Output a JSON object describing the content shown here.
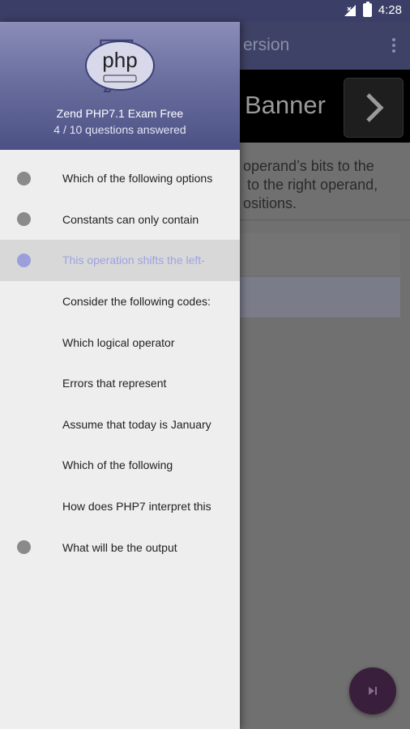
{
  "status_bar": {
    "time": "4:28"
  },
  "background": {
    "toolbar_title_fragment": "ersion",
    "banner_text": "Banner",
    "question_fragment": "operand’s bits to the\n to the right operand,\nositions."
  },
  "drawer": {
    "app_title": "Zend PHP7.1 Exam Free",
    "progress": "4 / 10 questions answered",
    "items": [
      {
        "label": "Which of the following options",
        "answered": true,
        "active": false
      },
      {
        "label": "Constants can only contain",
        "answered": true,
        "active": false
      },
      {
        "label": "This operation shifts the left-",
        "answered": true,
        "active": true
      },
      {
        "label": "Consider the following codes:",
        "answered": false,
        "active": false
      },
      {
        "label": "Which logical operator",
        "answered": false,
        "active": false
      },
      {
        "label": "Errors that represent",
        "answered": false,
        "active": false
      },
      {
        "label": "Assume that today is January",
        "answered": false,
        "active": false
      },
      {
        "label": "Which of the following",
        "answered": false,
        "active": false
      },
      {
        "label": "How does PHP7 interpret this",
        "answered": false,
        "active": false
      },
      {
        "label": "What will be the output",
        "answered": true,
        "active": false
      }
    ]
  },
  "logo": {
    "text": "php",
    "digit": "7"
  },
  "colors": {
    "header": "#6b6f9f",
    "accent": "#9a9fdc",
    "status_bar": "#3b3e66"
  },
  "icons": {
    "signal": "signal-icon",
    "battery": "battery-icon",
    "next": "chevron-right-icon",
    "menu": "more-vert-icon",
    "fab": "skip-next-icon"
  }
}
